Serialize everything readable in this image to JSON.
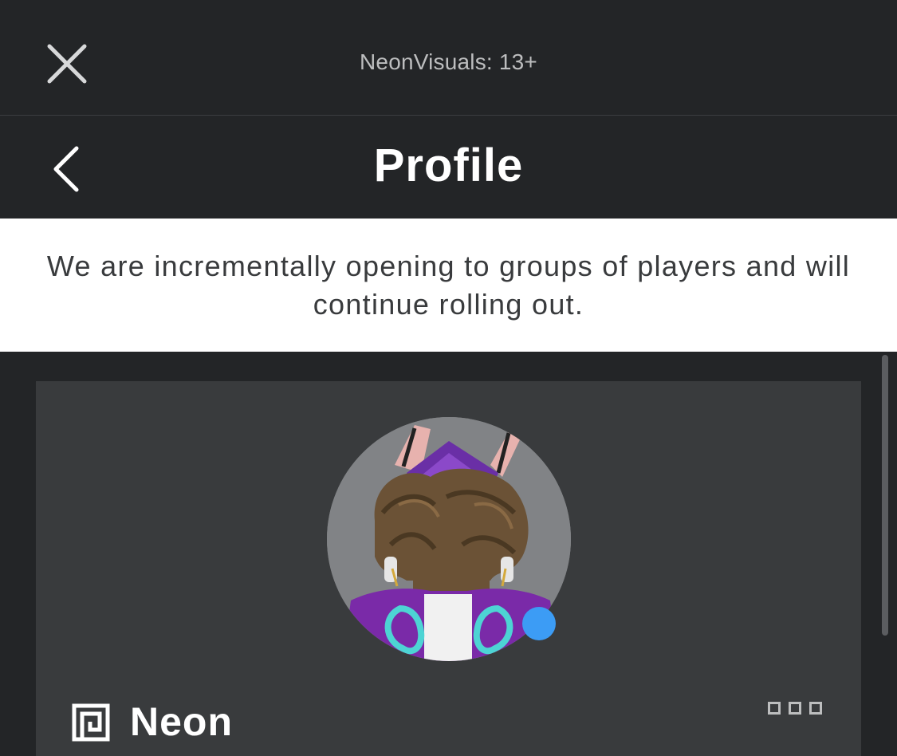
{
  "window": {
    "title": "NeonVisuals: 13+",
    "close_icon": "close-icon"
  },
  "nav": {
    "back_icon": "chevron-left-icon",
    "title": "Profile"
  },
  "notice": {
    "text": "We are incrementally opening to groups of players and will continue rolling out."
  },
  "profile": {
    "username": "Neon",
    "status": "online",
    "status_color": "#3c9cf5",
    "premium_icon": "premium-icon",
    "more_icon": "more-options-icon"
  },
  "colors": {
    "background": "#232527",
    "card": "#393b3d",
    "notice_bg": "#ffffff",
    "notice_text": "#393b3d"
  }
}
